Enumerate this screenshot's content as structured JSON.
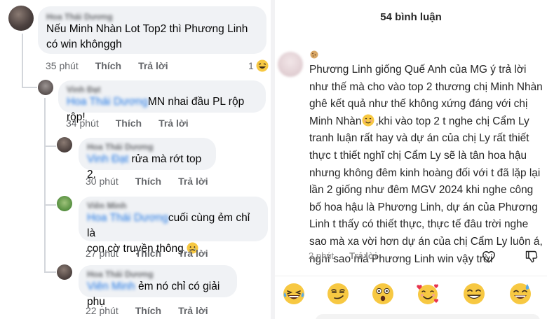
{
  "left_thread": {
    "comments": [
      {
        "name": "Hoa Thái Dương",
        "tag": "",
        "text": "Nếu Minh Nhàn Lot Top2 thì Phương Linh có win khônggh",
        "time": "35 phút",
        "like": "Thích",
        "reply": "Trả lời",
        "reaction_count": "1"
      },
      {
        "name": "Vinh Đạt",
        "tag": "Hoa Thái Dương",
        "text": "MN nhai đầu PL rộp rộp!",
        "time": "34 phút",
        "like": "Thích",
        "reply": "Trả lời"
      },
      {
        "name": "Hoa Thái Dương",
        "tag": "Vinh Đạt",
        "text": "rửa mà rớt top 2.",
        "time": "30 phút",
        "like": "Thích",
        "reply": "Trả lời"
      },
      {
        "name": "Viên Minh",
        "tag": "Hoa Thái Dương",
        "text_line1": "cuối cùng ẻm chỉ là",
        "text_line2": "con cờ truyền thông",
        "time": "27 phút",
        "like": "Thích",
        "reply": "Trả lời"
      },
      {
        "name": "Hoa Thái Dương",
        "tag": "Viên Minh",
        "text": "ẻm nó chỉ có giải phụ",
        "time": "22 phút",
        "like": "Thích",
        "reply": "Trả lời"
      }
    ]
  },
  "right_panel": {
    "title": "54 bình luận",
    "comment": {
      "text": "Phương Linh giống Quế Anh của MG ý trả lời như thế mà cho vào top 2 thương chị Minh Nhàn ghê kết quả như thế không xứng đáng với chị Minh Nhàn",
      "text_after_emoji": ",khi vào top 2 t nghe chị Cẩm Ly tranh luận rất hay và dự án của chị Ly rất thiết thực t thiết nghĩ chị Cẩm Ly sẽ là tân hoa hậu nhưng không đêm kinh hoàng đối với t đã lặp lại lần 2 giống như đêm MGV 2024 khi nghe công bố hoa hậu là Phương Linh, dự án của Phương Linh t thấy có thiết thực, thực tế đâu trời nghe sao mà xa vời hơn dự án của chị Cẩm Ly luôn á, nghĩ sao mà Phương Linh win vậy trời",
      "time": "2 phút",
      "reply": "Trả lời"
    },
    "quick_reactions": [
      "laughing-tears",
      "smirk",
      "surprised",
      "in-love",
      "grinning",
      "sweat-smile"
    ]
  }
}
